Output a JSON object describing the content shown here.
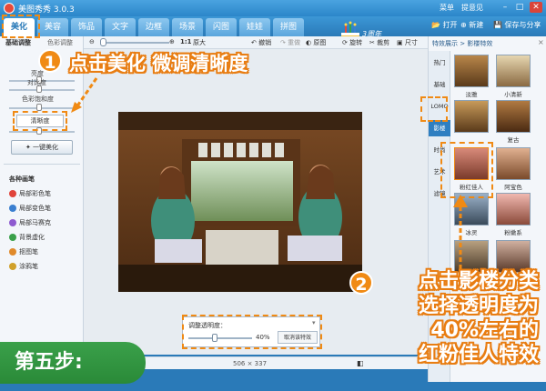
{
  "window": {
    "title": "美图秀秀 3.0.3",
    "menu_label": "菜单",
    "feedback_label": "提意见",
    "minimize": "–",
    "maximize": "□",
    "close": "✕"
  },
  "nav": {
    "tabs": [
      "美化",
      "美容",
      "饰品",
      "文字",
      "边框",
      "场景",
      "闪图",
      "娃娃",
      "拼图"
    ],
    "active_tab": "美化",
    "anniversary": "3周年",
    "open": "打开",
    "new": "新建",
    "save_share": "保存与分享"
  },
  "toolbar": {
    "zoom_ratio": "1:1",
    "original_size": "原大",
    "undo": "撤销",
    "redo": "重做",
    "original": "原图",
    "rotate": "旋转",
    "crop": "裁剪",
    "size": "尺寸"
  },
  "left_panel": {
    "tab_basic": "基础调整",
    "tab_color": "色彩调整",
    "labels": [
      "亮度",
      "对比度",
      "色彩饱和度",
      "清晰度"
    ],
    "clarity_button": "清晰度",
    "one_click_button": "一键美化",
    "brush_title": "各种画笔",
    "brushes": [
      "局部彩色笔",
      "局部变色笔",
      "局部马赛克",
      "背景虚化",
      "抠图笔",
      "涂鸦笔"
    ],
    "brush_colors": [
      "#e0433a",
      "#3a7fd0",
      "#8e5bd0",
      "#3aa04a",
      "#e08a2a",
      "#d0a02a"
    ]
  },
  "right_panel": {
    "header": "特效展示 > 影楼特效",
    "close_icon": "×",
    "categories": [
      "热门",
      "基础",
      "LOMO",
      "影楼",
      "时尚",
      "艺术",
      "滤镜"
    ],
    "active_category": "影楼",
    "effects": [
      "淡雅",
      "小清新",
      "",
      "复古",
      "粉红佳人",
      "阿宝色",
      "冰灵",
      "粉嫩系"
    ]
  },
  "adjust_panel": {
    "title": "调整透明度：",
    "value": "40%",
    "level": 0.4,
    "cancel": "取消该特效"
  },
  "status": {
    "image_size": "506 × 337"
  },
  "annotations": {
    "step1_num": "1",
    "step1_text": "点击美化 微调清晰度",
    "step2_num": "2",
    "step2_lines": [
      "点击影楼分类",
      "选择透明度为",
      "40%左右的",
      "红粉佳人特效"
    ],
    "step_badge": "第五步:",
    "accent": "#f08a14",
    "badge_color": "#2a8a38"
  }
}
